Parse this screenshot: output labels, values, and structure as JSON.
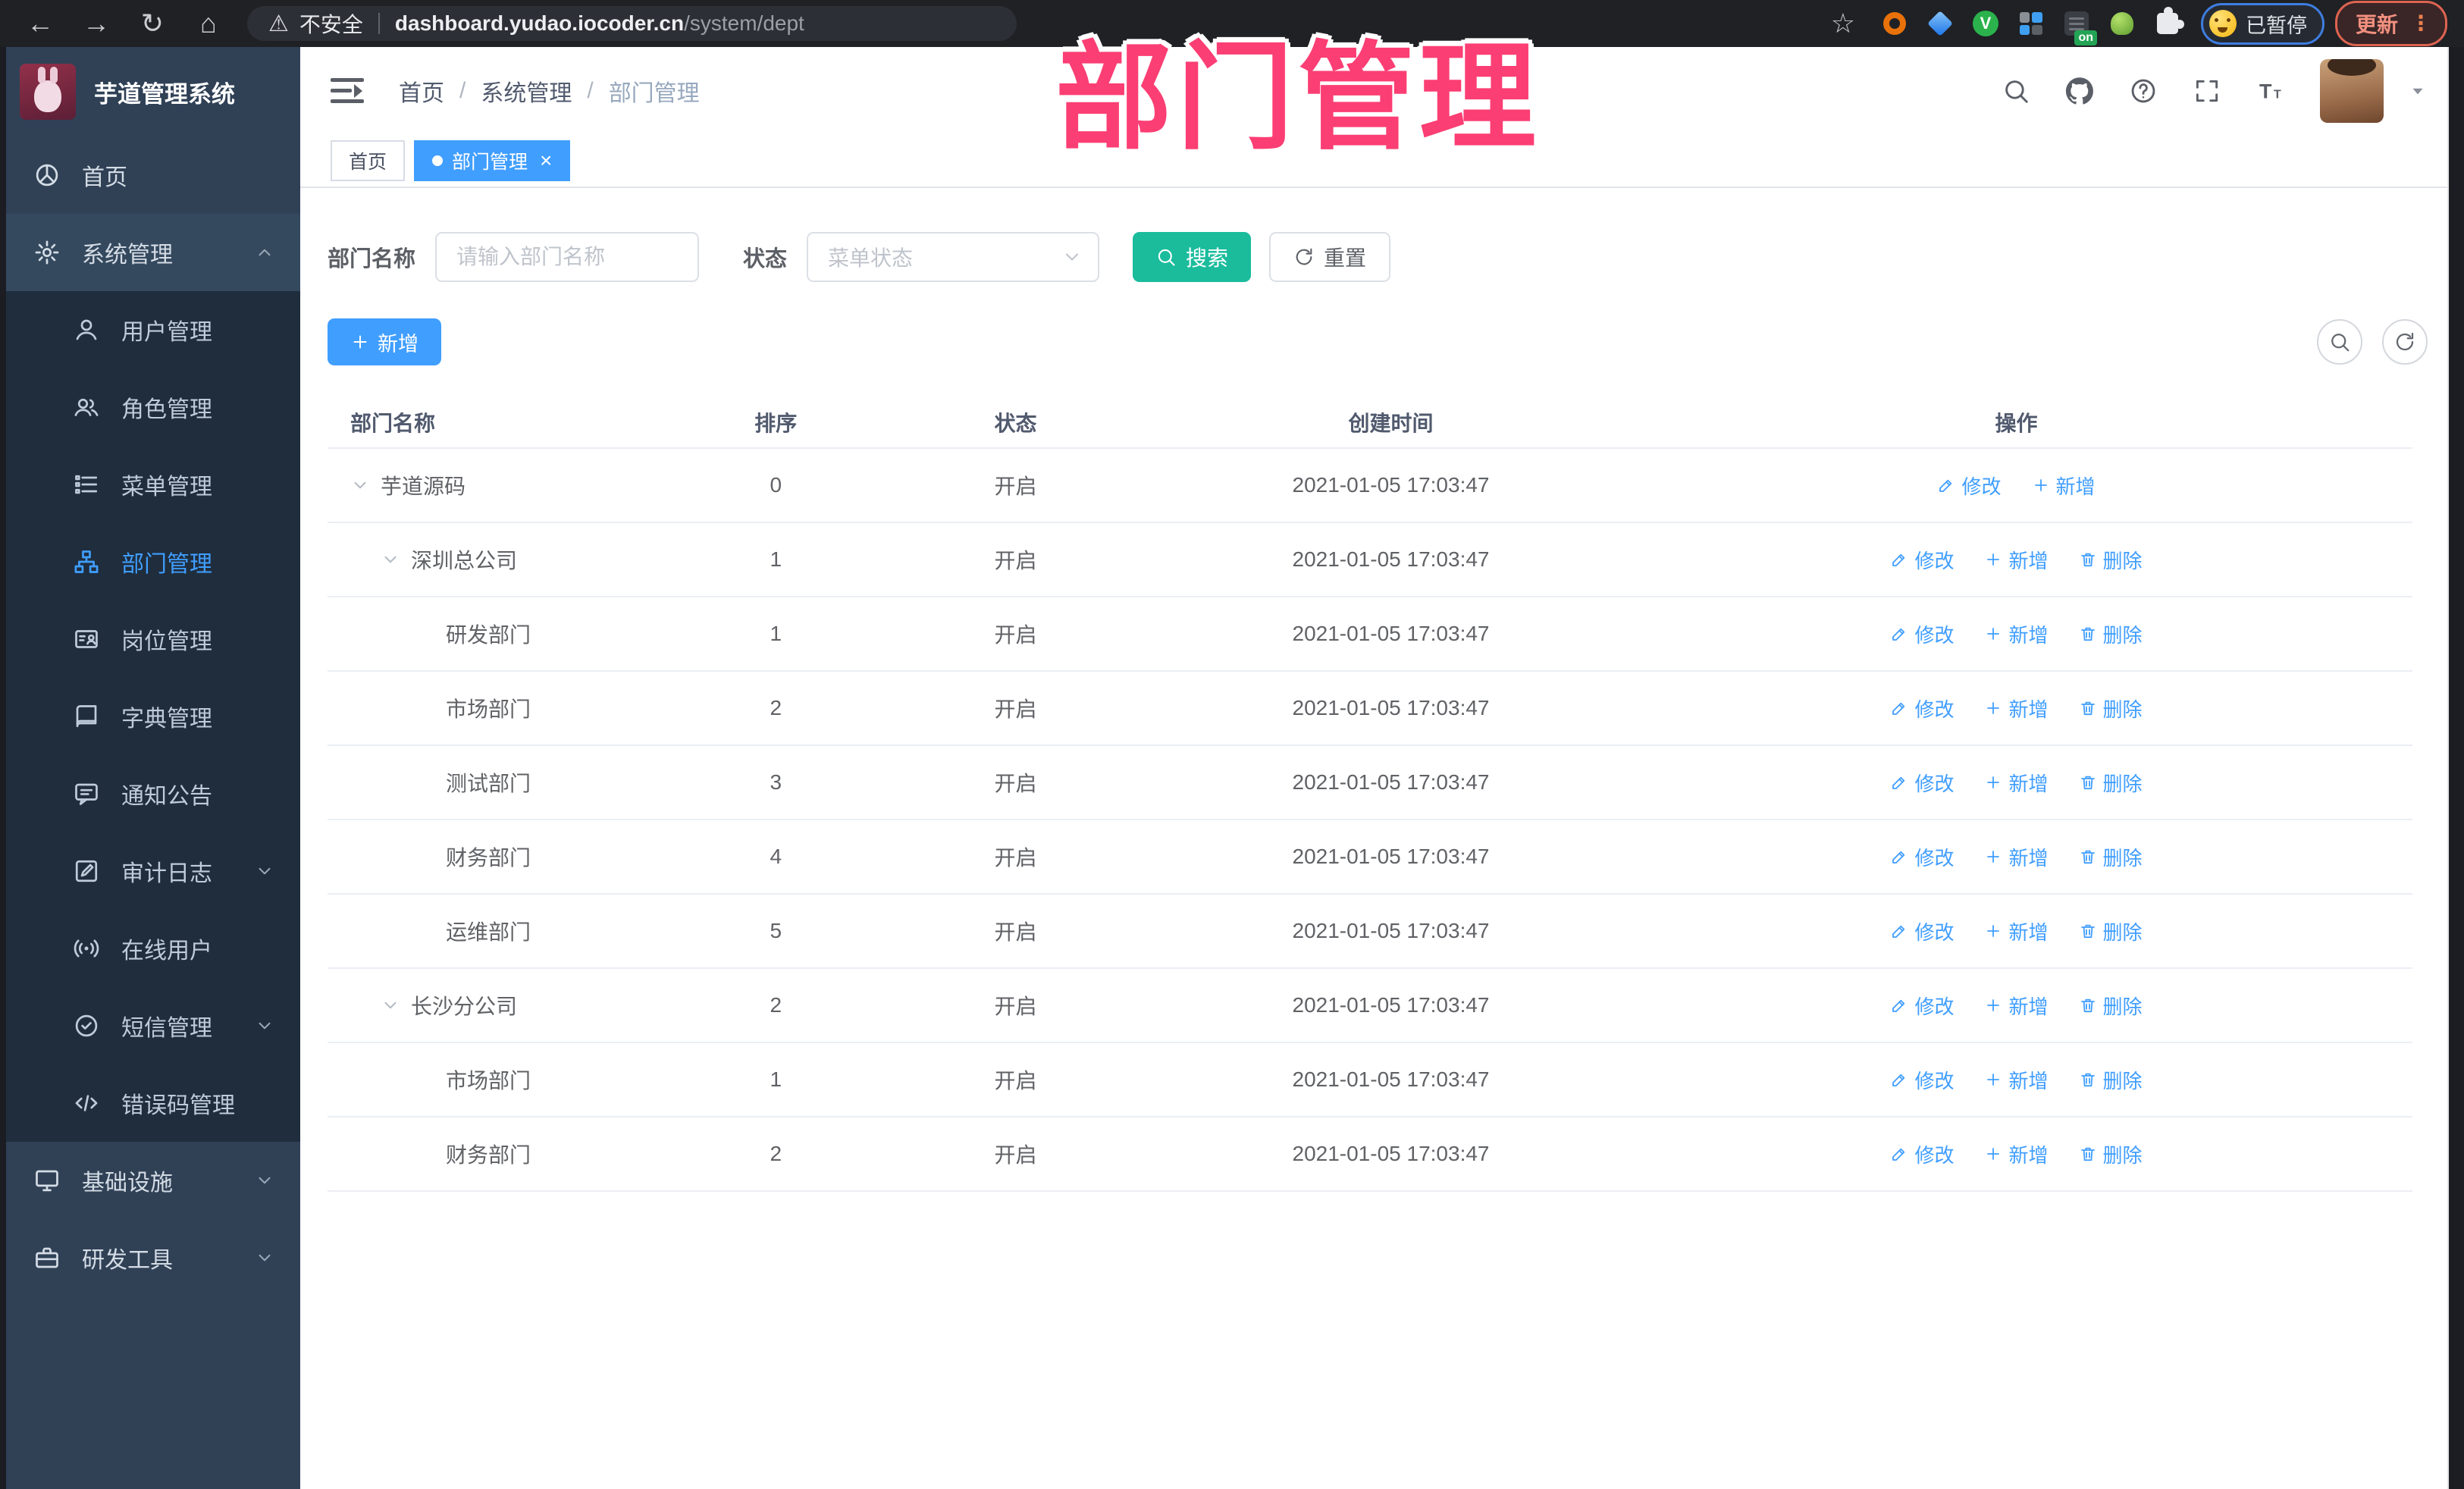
{
  "overlay_title": "部门管理",
  "browser": {
    "security_label": "不安全",
    "url_host": "dashboard.yudao.iocoder.cn",
    "url_path": "/system/dept",
    "paused_label": "已暂停",
    "update_label": "更新"
  },
  "sidebar": {
    "logo_title": "芋道管理系统",
    "items": [
      {
        "id": "home",
        "icon": "dashboard",
        "label": "首页",
        "level": 0
      },
      {
        "id": "system",
        "icon": "gear",
        "label": "系统管理",
        "level": 0,
        "chevron": "up",
        "highlight": true
      },
      {
        "id": "user",
        "icon": "user",
        "label": "用户管理",
        "level": 1
      },
      {
        "id": "role",
        "icon": "users",
        "label": "角色管理",
        "level": 1
      },
      {
        "id": "menu",
        "icon": "list",
        "label": "菜单管理",
        "level": 1
      },
      {
        "id": "dept",
        "icon": "tree",
        "label": "部门管理",
        "level": 1,
        "active": true
      },
      {
        "id": "post",
        "icon": "idcard",
        "label": "岗位管理",
        "level": 1
      },
      {
        "id": "dict",
        "icon": "book",
        "label": "字典管理",
        "level": 1
      },
      {
        "id": "notice",
        "icon": "bubble",
        "label": "通知公告",
        "level": 1
      },
      {
        "id": "audit",
        "icon": "editlog",
        "label": "审计日志",
        "level": 1,
        "chevron": "down"
      },
      {
        "id": "online",
        "icon": "online",
        "label": "在线用户",
        "level": 1
      },
      {
        "id": "sms",
        "icon": "sms",
        "label": "短信管理",
        "level": 1,
        "chevron": "down"
      },
      {
        "id": "errcode",
        "icon": "code",
        "label": "错误码管理",
        "level": 1
      },
      {
        "id": "infra",
        "icon": "monitor",
        "label": "基础设施",
        "level": 0,
        "chevron": "down"
      },
      {
        "id": "tools",
        "icon": "toolbox",
        "label": "研发工具",
        "level": 0,
        "chevron": "down"
      }
    ]
  },
  "header": {
    "breadcrumb": [
      "首页",
      "系统管理",
      "部门管理"
    ]
  },
  "tabs": [
    {
      "label": "首页",
      "active": false
    },
    {
      "label": "部门管理",
      "active": true,
      "closable": true
    }
  ],
  "search": {
    "name_label": "部门名称",
    "name_placeholder": "请输入部门名称",
    "status_label": "状态",
    "status_placeholder": "菜单状态",
    "search_label": "搜索",
    "reset_label": "重置"
  },
  "toolbar": {
    "add_label": "新增"
  },
  "table": {
    "headers": [
      "部门名称",
      "排序",
      "状态",
      "创建时间",
      "操作"
    ],
    "action_labels": {
      "edit": "修改",
      "add": "新增",
      "delete": "删除"
    },
    "rows": [
      {
        "name": "芋道源码",
        "level": 0,
        "expandable": true,
        "sort": "0",
        "status": "开启",
        "time": "2021-01-05 17:03:47",
        "actions": [
          "edit",
          "add"
        ]
      },
      {
        "name": "深圳总公司",
        "level": 1,
        "expandable": true,
        "sort": "1",
        "status": "开启",
        "time": "2021-01-05 17:03:47",
        "actions": [
          "edit",
          "add",
          "delete"
        ]
      },
      {
        "name": "研发部门",
        "level": 2,
        "expandable": false,
        "sort": "1",
        "status": "开启",
        "time": "2021-01-05 17:03:47",
        "actions": [
          "edit",
          "add",
          "delete"
        ]
      },
      {
        "name": "市场部门",
        "level": 2,
        "expandable": false,
        "sort": "2",
        "status": "开启",
        "time": "2021-01-05 17:03:47",
        "actions": [
          "edit",
          "add",
          "delete"
        ]
      },
      {
        "name": "测试部门",
        "level": 2,
        "expandable": false,
        "sort": "3",
        "status": "开启",
        "time": "2021-01-05 17:03:47",
        "actions": [
          "edit",
          "add",
          "delete"
        ]
      },
      {
        "name": "财务部门",
        "level": 2,
        "expandable": false,
        "sort": "4",
        "status": "开启",
        "time": "2021-01-05 17:03:47",
        "actions": [
          "edit",
          "add",
          "delete"
        ]
      },
      {
        "name": "运维部门",
        "level": 2,
        "expandable": false,
        "sort": "5",
        "status": "开启",
        "time": "2021-01-05 17:03:47",
        "actions": [
          "edit",
          "add",
          "delete"
        ]
      },
      {
        "name": "长沙分公司",
        "level": 1,
        "expandable": true,
        "sort": "2",
        "status": "开启",
        "time": "2021-01-05 17:03:47",
        "actions": [
          "edit",
          "add",
          "delete"
        ]
      },
      {
        "name": "市场部门",
        "level": 2,
        "expandable": false,
        "sort": "1",
        "status": "开启",
        "time": "2021-01-05 17:03:47",
        "actions": [
          "edit",
          "add",
          "delete"
        ]
      },
      {
        "name": "财务部门",
        "level": 2,
        "expandable": false,
        "sort": "2",
        "status": "开启",
        "time": "2021-01-05 17:03:47",
        "actions": [
          "edit",
          "add",
          "delete"
        ]
      }
    ]
  },
  "colors": {
    "accent": "#409EFF",
    "search_button": "#1ABC9C",
    "overlay_text": "#FB3E73",
    "sidebar_bg": "#304156",
    "submenu_bg": "#1F2D3D"
  }
}
